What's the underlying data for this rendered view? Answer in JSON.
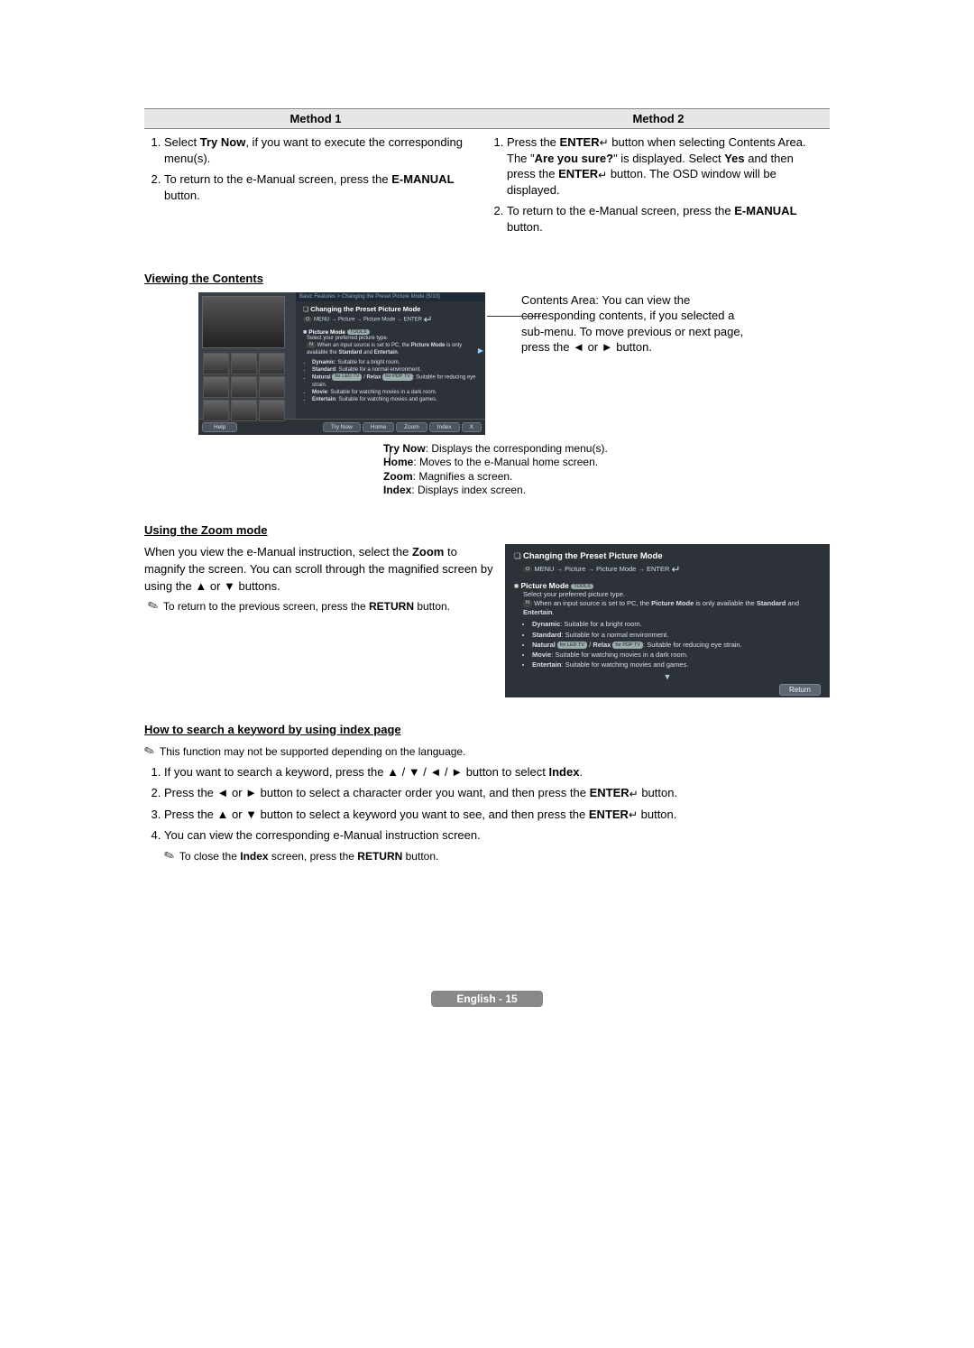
{
  "methods": {
    "h1": "Method 1",
    "h2": "Method 2",
    "m1": {
      "s1": {
        "pre": "Select ",
        "bold": "Try Now",
        "post": ", if you want to execute the corresponding menu(s)."
      },
      "s2": {
        "pre": "To return to the e-Manual screen, press the ",
        "bold": "E-MANUAL",
        "post": " button."
      }
    },
    "m2": {
      "s1": {
        "a": "Press the ",
        "enter": "ENTER",
        "b": " button when selecting Contents Area. The \"",
        "ays": "Are you sure?",
        "c": "\" is displayed. Select ",
        "yes": "Yes",
        "d": " and then press the ",
        "e": " button. The OSD window will be displayed."
      },
      "s2": {
        "pre": "To return to the e-Manual screen, press the ",
        "bold": "E-MANUAL",
        "post": " button."
      }
    }
  },
  "viewing": {
    "heading": "Viewing the Contents",
    "box": {
      "breadcrumb": "Basic Features > Changing the Preset Picture Mode (5/10)",
      "title": "Changing the Preset Picture Mode",
      "path_menu": "MENU",
      "path_rest": " → Picture → Picture Mode → ENTER",
      "pm": "Picture Mode",
      "pm_badge": "TOOLS",
      "select": "Select your preferred picture type.",
      "note_pre": "When an input source is set to PC, the ",
      "note_bold1": "Picture Mode",
      "note_mid": " is only available the ",
      "note_bold2": "Standard",
      "note_and": " and ",
      "note_bold3": "Entertain",
      "dot": ".",
      "bullets": [
        {
          "b": "Dynamic",
          "t": ": Suitable for a bright room."
        },
        {
          "b": "Standard",
          "t": ": Suitable for a normal environment."
        },
        {
          "b": "Natural",
          "led": "for LED TV",
          "sep": " / ",
          "b2": "Relax",
          "pdp": "for PDP TV",
          "t": ": Suitable for reducing eye strain."
        },
        {
          "b": "Movie",
          "t": ": Suitable for watching movies in a dark room."
        },
        {
          "b": "Entertain",
          "t": ": Suitable for watching movies and games."
        }
      ],
      "help": "Help",
      "btns": [
        "Try Now",
        "Home",
        "Zoom",
        "Index",
        "X"
      ]
    },
    "callout_right": "Contents Area: You can view the corresponding contents, if you selected a sub-menu. To move previous or next page, press the ◄ or ► button.",
    "callout_below": {
      "l1a": "Try Now",
      "l1b": ": Displays the corresponding menu(s).",
      "l2a": "Home",
      "l2b": ": Moves to the e-Manual home screen.",
      "l3a": "Zoom",
      "l3b": ": Magnifies a screen.",
      "l4a": "Index",
      "l4b": ": Displays index screen."
    }
  },
  "zoom": {
    "heading": "Using the Zoom mode",
    "para_a": "When you view the e-Manual instruction, select the ",
    "para_b": "Zoom",
    "para_c": " to magnify the screen. You can scroll through the magnified screen by using the ▲ or ▼ buttons.",
    "note_pre": "To return to the previous screen, press the ",
    "note_bold": "RETURN",
    "note_post": " button.",
    "box": {
      "title": "Changing the Preset Picture Mode",
      "menu": "MENU",
      "path": " → Picture → Picture Mode → ENTER",
      "pm": "Picture Mode",
      "pm_badge": "TOOLS",
      "select": "Select your preferred picture type.",
      "return": "Return"
    }
  },
  "index": {
    "heading": "How to search a keyword by using index page",
    "note": "This function may not be supported depending on the language.",
    "s1": {
      "a": "If you want to search a keyword, press the ▲ / ▼ / ◄ / ► button to select ",
      "b": "Index",
      "c": "."
    },
    "s2": {
      "a": "Press the ◄ or ► button to select a character order you want, and then press the ",
      "enter": "ENTER",
      "b": " button."
    },
    "s3": {
      "a": "Press the ▲ or ▼ button to select a keyword you want to see, and then press the ",
      "enter": "ENTER",
      "b": " button."
    },
    "s4": "You can view the corresponding e-Manual instruction screen.",
    "close": {
      "a": "To close the ",
      "b": "Index",
      "c": " screen, press the ",
      "d": "RETURN",
      "e": " button."
    }
  },
  "footer": "English - 15",
  "chart_data": null
}
